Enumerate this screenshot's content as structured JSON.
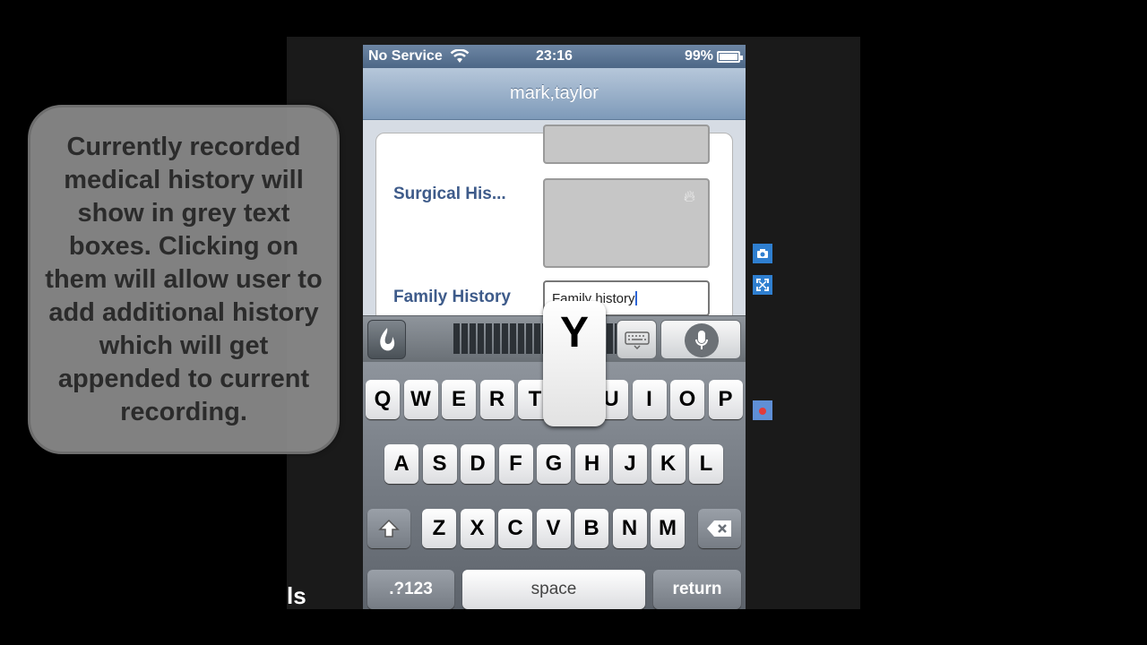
{
  "tutorial": {
    "callout_text": "Currently recorded medical history will show in grey text boxes. Clicking on them will allow user to add additional history which will get appended to current recording.",
    "frame_text": "ls"
  },
  "status_bar": {
    "carrier": "No Service",
    "time": "23:16",
    "battery_percent": "99%",
    "battery_level": 0.99
  },
  "nav": {
    "title": "mark,taylor"
  },
  "form": {
    "previous_field_value": "",
    "surgical_label": "Surgical His...",
    "surgical_value": "",
    "family_label": "Family History",
    "family_value": "Family history"
  },
  "dictation_bar": {
    "dragon_icon": "dragon-flame-icon",
    "keyboard_icon": "keyboard-icon",
    "mic_icon": "microphone-icon"
  },
  "keyboard": {
    "row1": [
      "Q",
      "W",
      "E",
      "R",
      "T",
      "Y",
      "U",
      "I",
      "O",
      "P"
    ],
    "row2": [
      "A",
      "S",
      "D",
      "F",
      "G",
      "H",
      "J",
      "K",
      "L"
    ],
    "row3": [
      "Z",
      "X",
      "C",
      "V",
      "B",
      "N",
      "M"
    ],
    "shift_icon": "shift-icon",
    "backspace_icon": "backspace-icon",
    "numbers_label": ".?123",
    "space_label": "space",
    "return_label": "return",
    "pressed_key": "Y"
  },
  "side_tools": [
    "camera-icon",
    "fullscreen-icon",
    "record-icon"
  ]
}
